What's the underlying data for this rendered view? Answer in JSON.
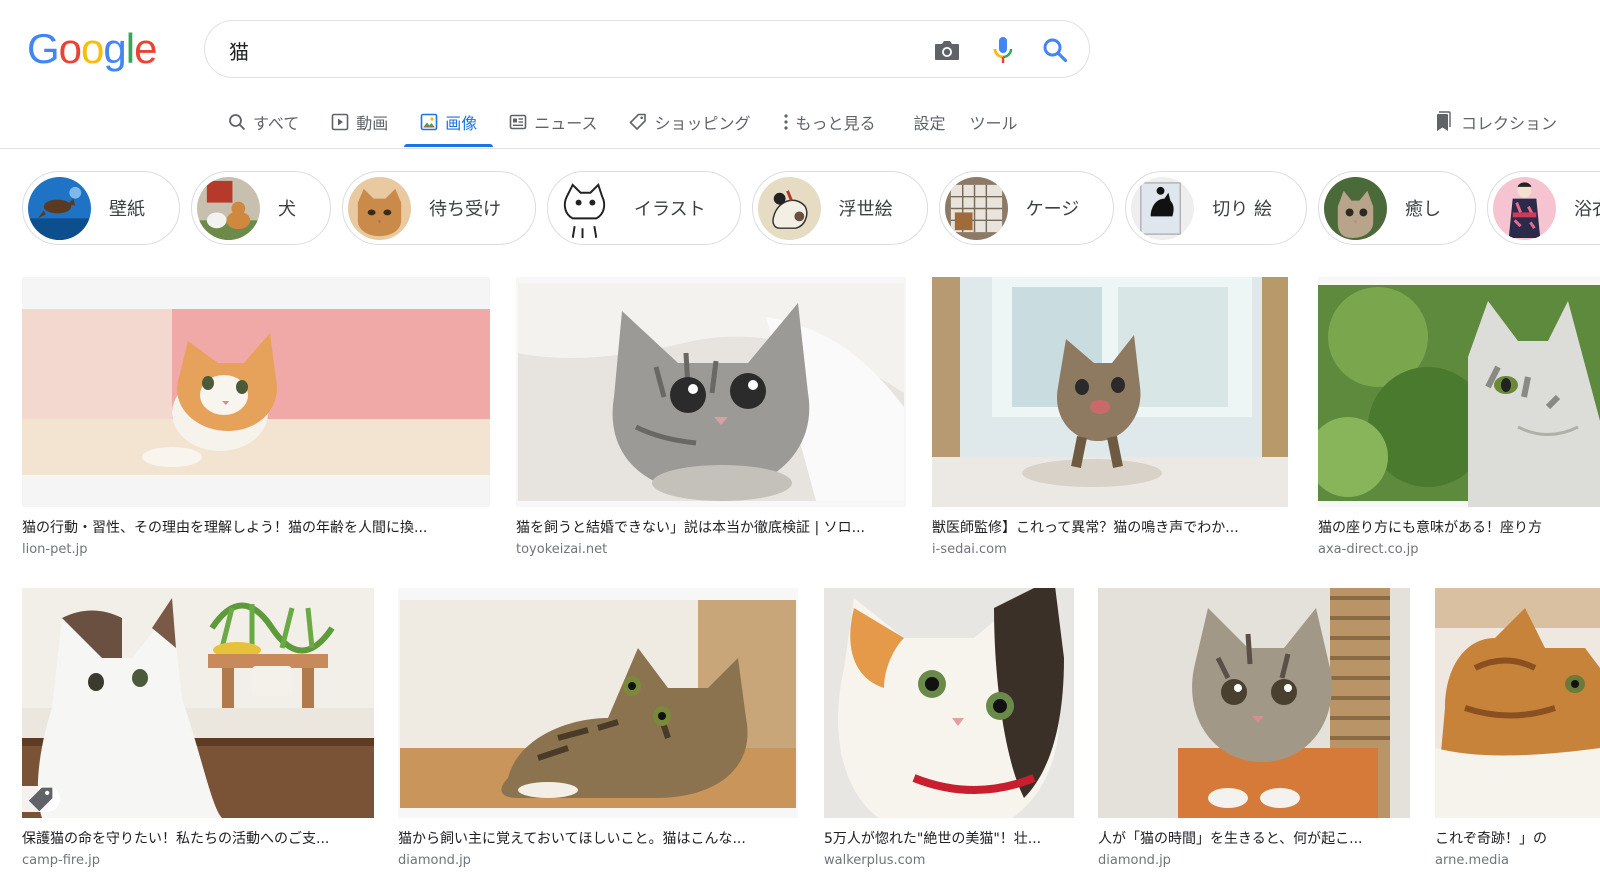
{
  "logo": {
    "letters": [
      "G",
      "o",
      "o",
      "g",
      "l",
      "e"
    ],
    "colors": [
      "#4285F4",
      "#EA4335",
      "#FBBC05",
      "#4285F4",
      "#34A853",
      "#EA4335"
    ]
  },
  "search": {
    "query": "猫",
    "icons": [
      "camera-icon",
      "microphone-icon",
      "search-icon"
    ]
  },
  "nav": {
    "tabs": [
      {
        "label": "すべて",
        "icon": "search-icon"
      },
      {
        "label": "動画",
        "icon": "play-icon"
      },
      {
        "label": "画像",
        "icon": "image-icon",
        "active": true
      },
      {
        "label": "ニュース",
        "icon": "news-icon"
      },
      {
        "label": "ショッピング",
        "icon": "tag-icon"
      },
      {
        "label": "もっと見る",
        "icon": "more-vert-icon"
      }
    ],
    "settings_label": "設定",
    "tools_label": "ツール",
    "collection_label": "コレクション",
    "active_color": "#1a73e8"
  },
  "chips": [
    {
      "label": "壁紙"
    },
    {
      "label": "犬"
    },
    {
      "label": "待ち受け"
    },
    {
      "label": "イラスト"
    },
    {
      "label": "浮世絵"
    },
    {
      "label": "ケージ"
    },
    {
      "label": "切り 絵"
    },
    {
      "label": "癒し"
    },
    {
      "label": "浴衣"
    }
  ],
  "results": [
    {
      "title": "猫の行動・習性、その理由を理解しよう！猫の年齢を人間に換...",
      "domain": "lion-pet.jp"
    },
    {
      "title": "猫を飼うと結婚できない」説は本当か徹底検証 | ソロ...",
      "domain": "toyokeizai.net"
    },
    {
      "title": "獣医師監修】これって異常？猫の鳴き声でわか...",
      "domain": "i-sedai.com"
    },
    {
      "title": "猫の座り方にも意味がある！座り方",
      "domain": "axa-direct.co.jp"
    },
    {
      "title": "保護猫の命を守りたい！私たちの活動へのご支...",
      "domain": "camp-fire.jp",
      "badge": "tag-icon"
    },
    {
      "title": "猫から飼い主に覚えておいてほしいこと。猫はこんな...",
      "domain": "diamond.jp"
    },
    {
      "title": "5万人が惚れた\"絶世の美猫\"！壮...",
      "domain": "walkerplus.com"
    },
    {
      "title": "人が「猫の時間」を生きると、何が起こ...",
      "domain": "diamond.jp"
    },
    {
      "title": "これぞ奇跡！」の",
      "domain": "arne.media"
    }
  ]
}
